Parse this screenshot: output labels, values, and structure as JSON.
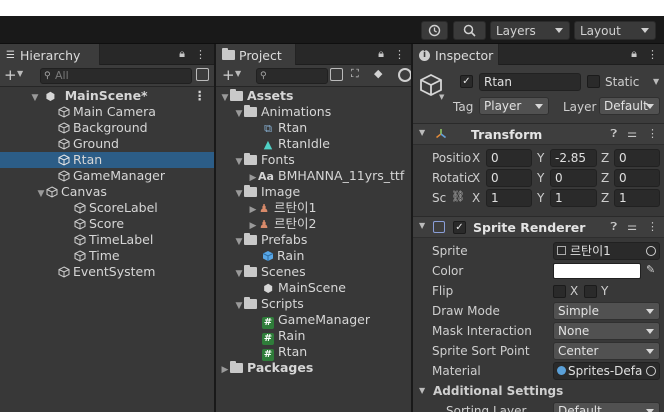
{
  "toolbar": {
    "layers_label": "Layers",
    "layout_label": "Layout"
  },
  "hierarchy": {
    "tab_label": "Hierarchy",
    "search_placeholder": "All",
    "items": [
      {
        "label": "MainScene*",
        "icon": "unity-scene-icon"
      },
      {
        "label": "Main Camera",
        "icon": "gameobject-cube-icon"
      },
      {
        "label": "Background",
        "icon": "gameobject-cube-icon"
      },
      {
        "label": "Ground",
        "icon": "gameobject-cube-icon"
      },
      {
        "label": "Rtan",
        "icon": "gameobject-cube-icon"
      },
      {
        "label": "GameManager",
        "icon": "gameobject-cube-icon"
      },
      {
        "label": "Canvas",
        "icon": "gameobject-cube-icon"
      },
      {
        "label": "ScoreLabel",
        "icon": "gameobject-cube-icon"
      },
      {
        "label": "Score",
        "icon": "gameobject-cube-icon"
      },
      {
        "label": "TimeLabel",
        "icon": "gameobject-cube-icon"
      },
      {
        "label": "Time",
        "icon": "gameobject-cube-icon"
      },
      {
        "label": "EventSystem",
        "icon": "gameobject-cube-icon"
      }
    ]
  },
  "project": {
    "tab_label": "Project",
    "items": [
      {
        "label": "Assets",
        "icon": "folder-icon"
      },
      {
        "label": "Animations",
        "icon": "folder-icon"
      },
      {
        "label": "Rtan",
        "icon": "animator-controller-icon"
      },
      {
        "label": "RtanIdle",
        "icon": "animation-clip-icon"
      },
      {
        "label": "Fonts",
        "icon": "folder-icon"
      },
      {
        "label": "BMHANNA_11yrs_ttf",
        "icon": "font-icon"
      },
      {
        "label": "Image",
        "icon": "folder-icon"
      },
      {
        "label": "르탄이1",
        "icon": "sprite-icon"
      },
      {
        "label": "르탄이2",
        "icon": "sprite-icon"
      },
      {
        "label": "Prefabs",
        "icon": "folder-icon"
      },
      {
        "label": "Rain",
        "icon": "prefab-icon"
      },
      {
        "label": "Scenes",
        "icon": "folder-icon"
      },
      {
        "label": "MainScene",
        "icon": "unity-scene-icon"
      },
      {
        "label": "Scripts",
        "icon": "folder-icon"
      },
      {
        "label": "GameManager",
        "icon": "script-icon"
      },
      {
        "label": "Rain",
        "icon": "script-icon"
      },
      {
        "label": "Rtan",
        "icon": "script-icon"
      },
      {
        "label": "Packages",
        "icon": "folder-icon"
      }
    ]
  },
  "inspector": {
    "tab_label": "Inspector",
    "object_name": "Rtan",
    "static_label": "Static",
    "tag_label": "Tag",
    "tag_value": "Player",
    "layer_label": "Layer",
    "layer_value": "Default",
    "transform": {
      "title": "Transform",
      "position_label": "Positio",
      "rotation_label": "Rotatic",
      "scale_label": "Sc",
      "x": "X",
      "y": "Y",
      "z": "Z",
      "position": [
        "0",
        "-2.85",
        "0"
      ],
      "rotation": [
        "0",
        "0",
        "0"
      ],
      "scale": [
        "1",
        "1",
        "1"
      ]
    },
    "sprite_renderer": {
      "title": "Sprite Renderer",
      "sprite_label": "Sprite",
      "sprite_value": "르탄이1",
      "color_label": "Color",
      "color_value": "#ffffff",
      "flip_label": "Flip",
      "flip_x": "X",
      "flip_y": "Y",
      "draw_mode_label": "Draw Mode",
      "draw_mode_value": "Simple",
      "mask_label": "Mask Interaction",
      "mask_value": "None",
      "sort_point_label": "Sprite Sort Point",
      "sort_point_value": "Center",
      "material_label": "Material",
      "material_value": "Sprites-Defa",
      "additional_label": "Additional Settings",
      "sorting_layer_label": "Sorting Layer",
      "sorting_layer_value": "Default"
    }
  },
  "colors": {
    "selection": "#2c5d87",
    "panel_bg": "#383838",
    "toolbar_bg": "#191919"
  }
}
